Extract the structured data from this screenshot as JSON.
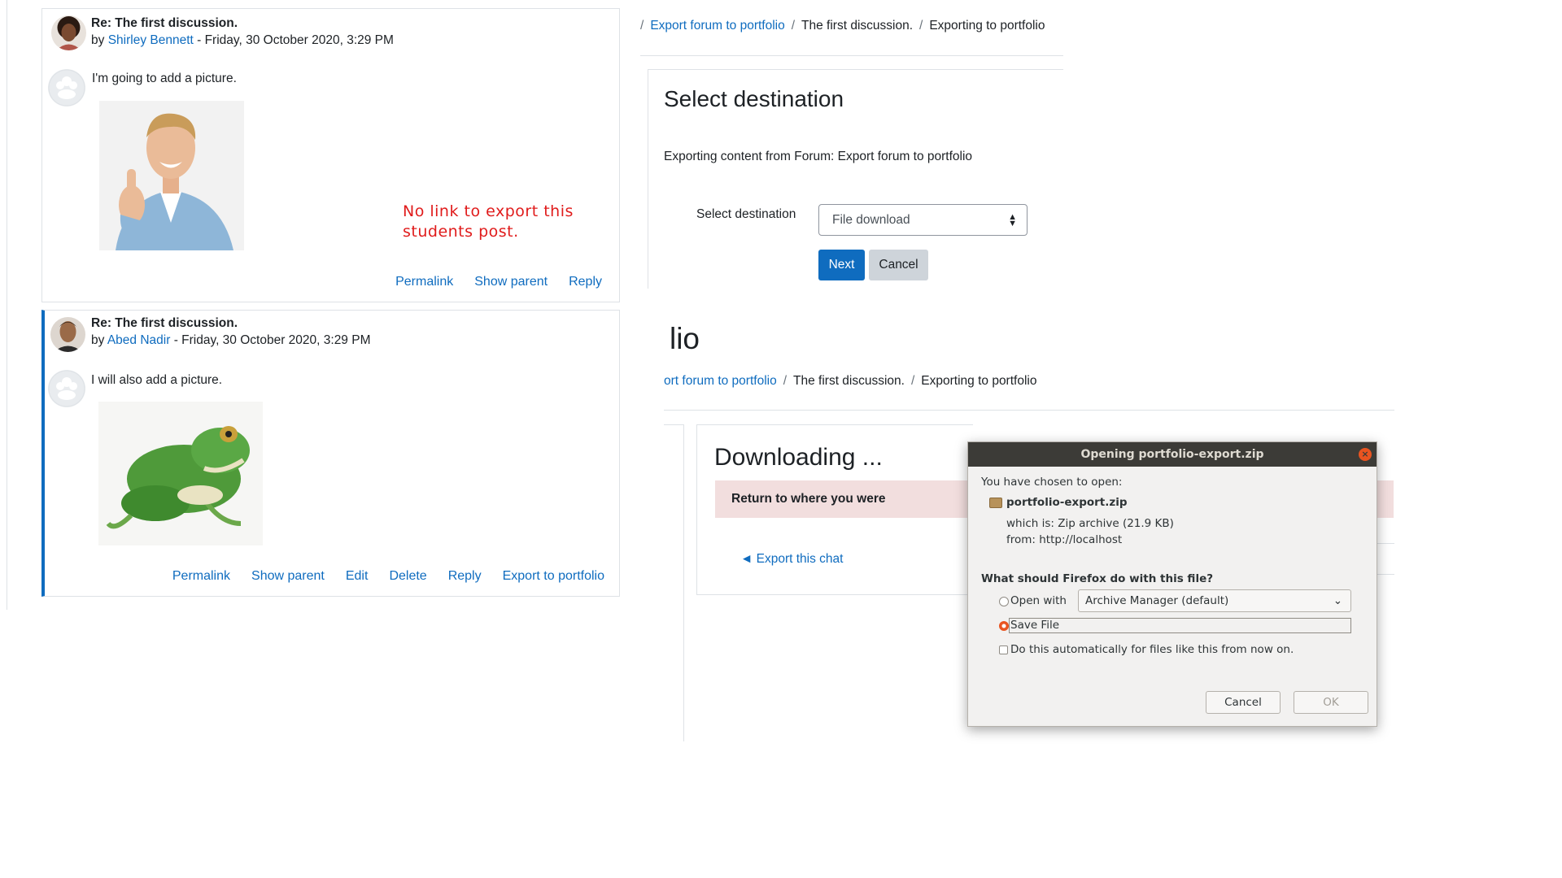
{
  "posts": [
    {
      "subject": "Re: The first discussion.",
      "by_prefix": "by",
      "author": "Shirley Bennett",
      "date": "- Friday, 30 October 2020, 3:29 PM",
      "body": "I'm going to add a picture.",
      "image": "man-thumbs-up-photo",
      "actions": [
        "Permalink",
        "Show parent",
        "Reply"
      ]
    },
    {
      "subject": "Re: The first discussion.",
      "by_prefix": "by",
      "author": "Abed Nadir",
      "date": "- Friday, 30 October 2020, 3:29 PM",
      "body": "I will also add a picture.",
      "image": "frog-photo",
      "actions": [
        "Permalink",
        "Show parent",
        "Edit",
        "Delete",
        "Reply",
        "Export to portfolio"
      ]
    }
  ],
  "annotation": {
    "line1": "No link to export this",
    "line2": "students post."
  },
  "select_destination": {
    "breadcrumb": [
      "Export forum to portfolio",
      "The first discussion.",
      "Exporting to portfolio"
    ],
    "title": "Select destination",
    "description": "Exporting content from Forum: Export forum to portfolio",
    "field_label": "Select destination",
    "selected": "File download",
    "next_label": "Next",
    "cancel_label": "Cancel"
  },
  "downloading": {
    "heading_fragment": "lio",
    "breadcrumb": [
      "ort forum to portfolio",
      "The first discussion.",
      "Exporting to portfolio"
    ],
    "title": "Downloading ...",
    "alert": "Return to where you were",
    "back_link": "◄ Export this chat"
  },
  "dialog": {
    "title": "Opening portfolio-export.zip",
    "chosen_label": "You have chosen to open:",
    "filename": "portfolio-export.zip",
    "which_is": "which is: Zip archive (21.9 KB)",
    "from": "from: http://localhost",
    "question": "What should Firefox do with this file?",
    "open_with_label": "Open with",
    "open_with_app": "Archive Manager (default)",
    "save_file_label": "Save File",
    "auto_label": "Do this automatically for files like this from now on.",
    "selected_option": "save-file",
    "cancel_label": "Cancel",
    "ok_label": "OK"
  },
  "colors": {
    "link": "#0f6cbf",
    "primary": "#0f6cbf",
    "annotation": "#e01b1b",
    "alert_bg": "#f2dede",
    "dialog_titlebar": "#3c3b37",
    "ubuntu_orange": "#e95420"
  }
}
